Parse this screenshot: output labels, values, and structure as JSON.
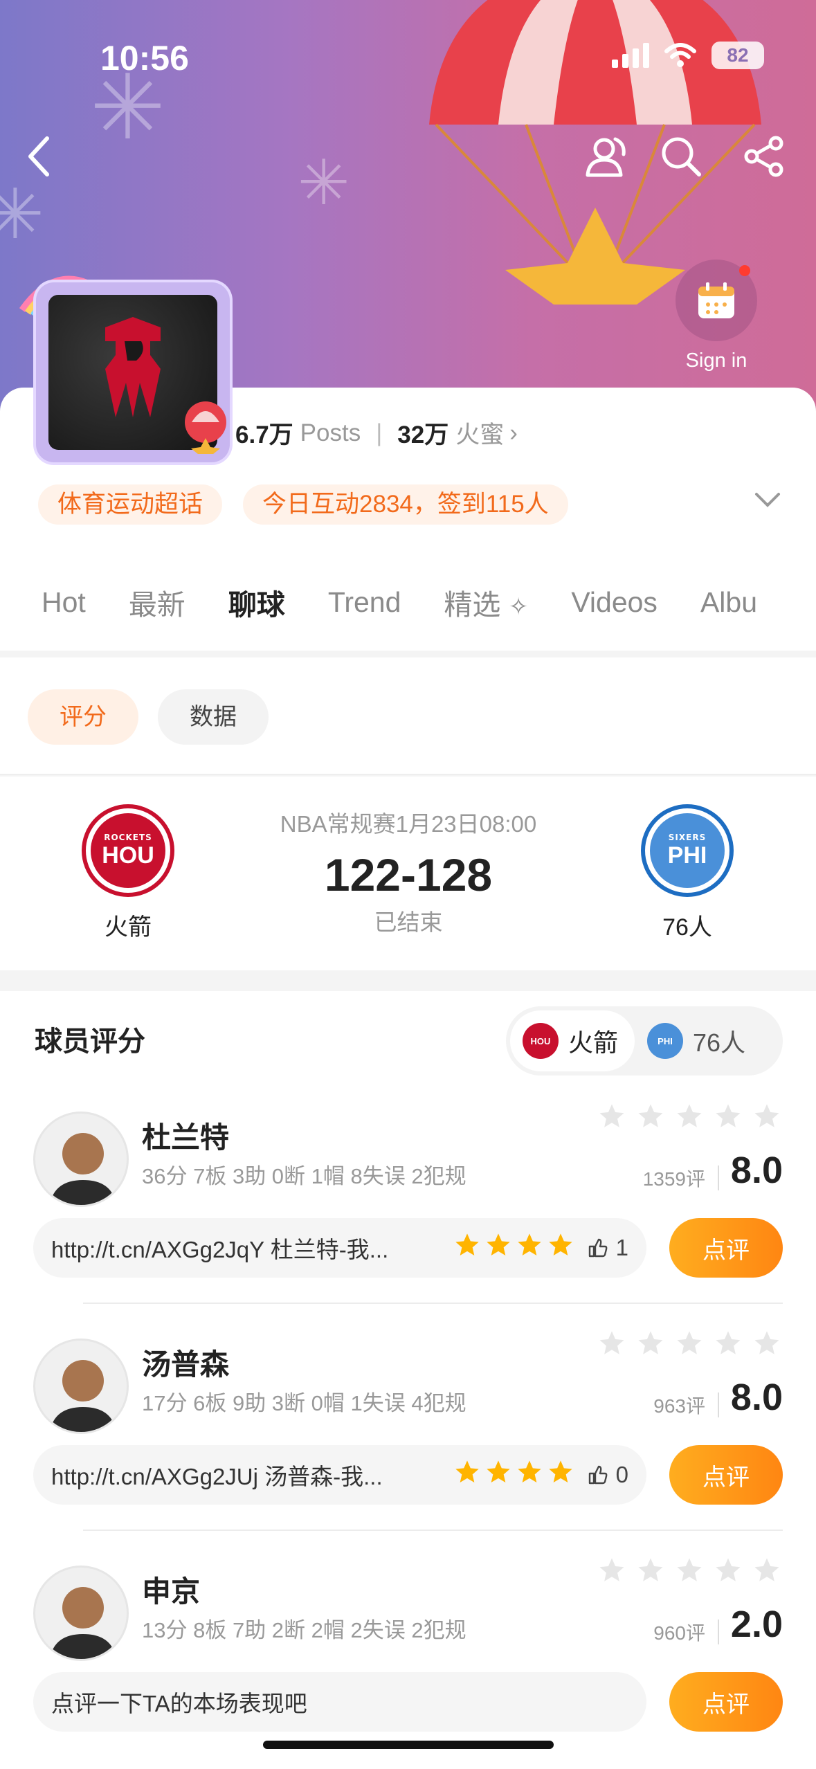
{
  "status_bar": {
    "time": "10:56",
    "battery": "82"
  },
  "header": {
    "sign_in_label": "Sign in"
  },
  "profile": {
    "posts_count": "6.7万",
    "posts_label": "Posts",
    "fans_count": "32万",
    "fans_label": "火蜜",
    "tags": [
      "体育运动超话",
      "今日互动2834，签到115人"
    ]
  },
  "tabs": [
    {
      "label": "Hot",
      "active": false
    },
    {
      "label": "最新",
      "active": false
    },
    {
      "label": "聊球",
      "active": true
    },
    {
      "label": "Trend",
      "active": false
    },
    {
      "label": "精选",
      "active": false
    },
    {
      "label": "Videos",
      "active": false
    },
    {
      "label": "Albu",
      "active": false
    }
  ],
  "subtabs": {
    "rating": "评分",
    "data": "数据"
  },
  "game": {
    "meta": "NBA常规赛1月23日08:00",
    "score": "122-128",
    "status": "已结束",
    "home": {
      "name": "火箭",
      "logo_small": "ROCKETS",
      "logo_big": "HOU",
      "color": "#c8102e"
    },
    "away": {
      "name": "76人",
      "logo_small": "SIXERS",
      "logo_big": "PHI",
      "color": "#1d6dc2"
    }
  },
  "ratings": {
    "title": "球员评分",
    "switch_home": "火箭",
    "switch_away": "76人",
    "players": [
      {
        "name": "杜兰特",
        "stats": "36分 7板 3助 0断 1帽 8失误 2犯规",
        "count": "1359评",
        "score": "8.0",
        "comment": "http://t.cn/AXGg2JqY 杜兰特-我...",
        "comment_stars": 4,
        "likes": "1",
        "button": "点评"
      },
      {
        "name": "汤普森",
        "stats": "17分 6板 9助 3断 0帽 1失误 4犯规",
        "count": "963评",
        "score": "8.0",
        "comment": "http://t.cn/AXGg2JUj 汤普森-我...",
        "comment_stars": 4,
        "likes": "0",
        "button": "点评"
      },
      {
        "name": "申京",
        "stats": "13分 8板 7助 2断 2帽 2失误 2犯规",
        "count": "960评",
        "score": "2.0",
        "comment": "点评一下TA的本场表现吧",
        "comment_stars": 0,
        "likes": "",
        "button": "点评"
      }
    ]
  }
}
